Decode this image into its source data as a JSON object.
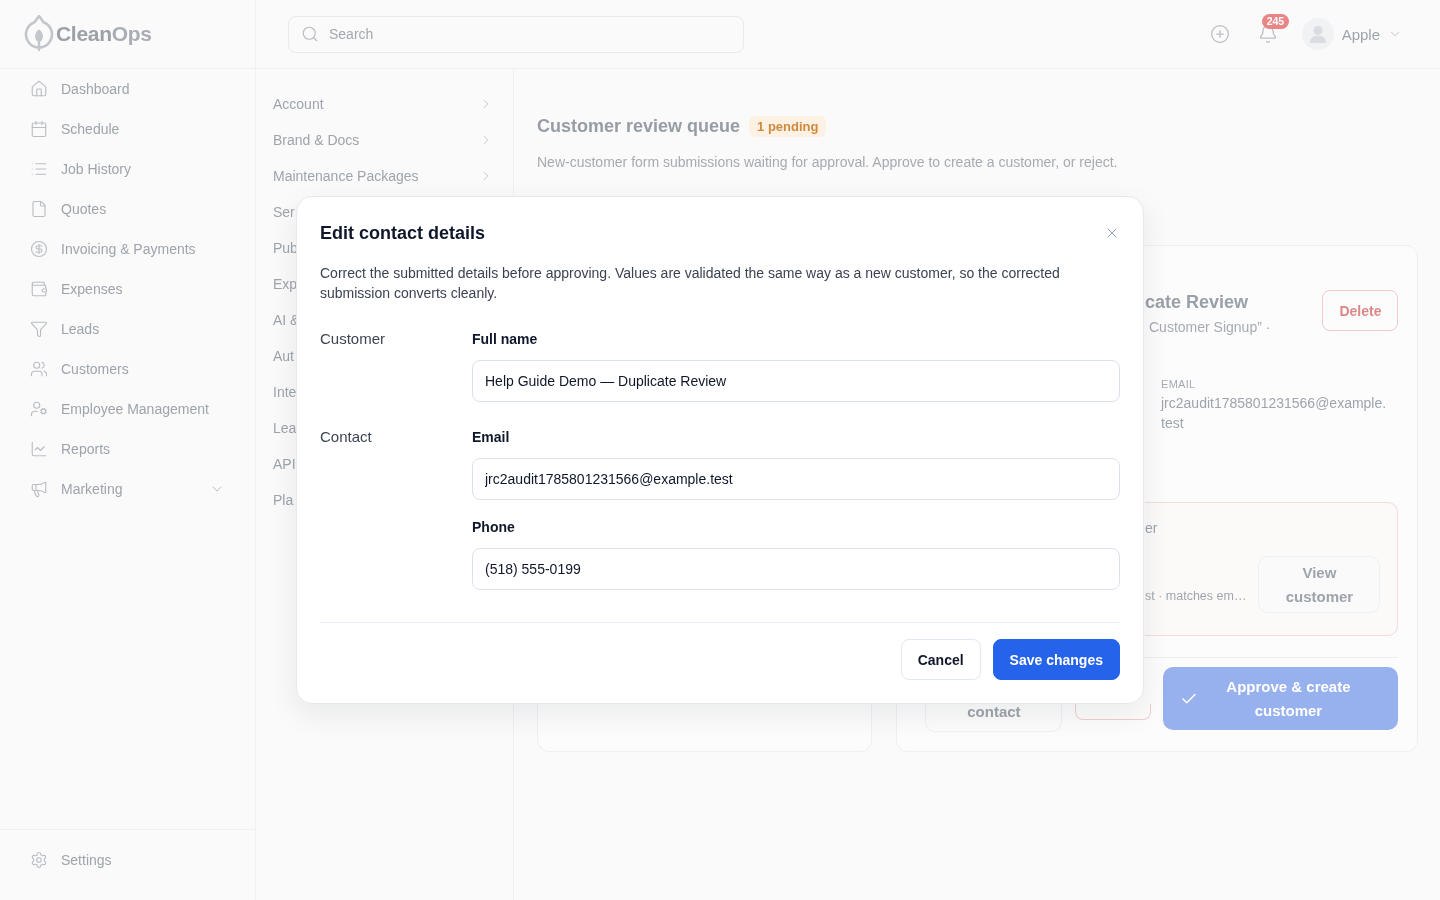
{
  "sidebar": {
    "logo": {
      "text": "Clean",
      "accent": "Ops"
    },
    "items": [
      {
        "label": "Dashboard",
        "kind": "link"
      },
      {
        "label": "Schedule",
        "kind": "link"
      },
      {
        "label": "Job History",
        "kind": "link"
      },
      {
        "label": "Quotes",
        "kind": "link"
      },
      {
        "label": "Invoicing & Payments",
        "kind": "link"
      },
      {
        "label": "Expenses",
        "kind": "link"
      },
      {
        "label": "Leads",
        "kind": "link"
      },
      {
        "label": "Customers",
        "kind": "link"
      },
      {
        "label": "Employee Management",
        "kind": "link"
      },
      {
        "label": "Reports",
        "kind": "link"
      },
      {
        "label": "Marketing",
        "kind": "group"
      }
    ],
    "settings": {
      "label": "Settings"
    }
  },
  "topbar": {
    "search": {
      "placeholder": "Search"
    },
    "notifications": {
      "count": "245"
    },
    "user": {
      "name": "Apple"
    }
  },
  "settings_nav": {
    "items": [
      {
        "label": "Account",
        "chevron": true
      },
      {
        "label": "Brand & Docs",
        "chevron": true
      },
      {
        "label": "Maintenance Packages",
        "chevron": true
      },
      {
        "label": "Ser",
        "chevron": false
      },
      {
        "label": "Pub",
        "chevron": false
      },
      {
        "label": "Exp",
        "chevron": false
      },
      {
        "label": "AI &",
        "chevron": false
      },
      {
        "label": "Aut",
        "chevron": false
      },
      {
        "label": "Inte",
        "chevron": false
      },
      {
        "label": "Lea",
        "chevron": false
      },
      {
        "label": "API",
        "chevron": false
      },
      {
        "label": "Pla",
        "chevron": false
      }
    ]
  },
  "review_queue": {
    "title": "Customer review queue",
    "badge": "1 pending",
    "description": "New-customer form submissions waiting for approval. Approve to create a customer, or reject.",
    "detail": {
      "title": "cate Review",
      "subtitle": "Customer Signup” ·",
      "delete_button": "Delete",
      "email_label": "EMAIL",
      "email_value": "jrc2audit1785801231566@example.test",
      "match": {
        "heading": "er",
        "detail": "st · matches em…",
        "button": "View customer"
      },
      "actions": [
        {
          "kind": "contact",
          "label": "contact"
        },
        {
          "kind": "reject"
        },
        {
          "kind": "approve",
          "label": "Approve & create customer"
        }
      ]
    }
  },
  "dialog": {
    "title": "Edit contact details",
    "description": "Correct the submitted details before approving. Values are validated the same way as a new customer, so the corrected submission converts cleanly.",
    "sections": [
      {
        "label": "Customer",
        "fields": [
          {
            "label": "Full name",
            "value": "Help Guide Demo — Duplicate Review"
          }
        ]
      },
      {
        "label": "Contact",
        "fields": [
          {
            "label": "Email",
            "value": "jrc2audit1785801231566@example.test"
          },
          {
            "label": "Phone",
            "value": "(518) 555-0199"
          }
        ]
      }
    ],
    "buttons": [
      {
        "kind": "secondary",
        "label": "Cancel"
      },
      {
        "kind": "primary",
        "label": "Save changes"
      }
    ]
  }
}
